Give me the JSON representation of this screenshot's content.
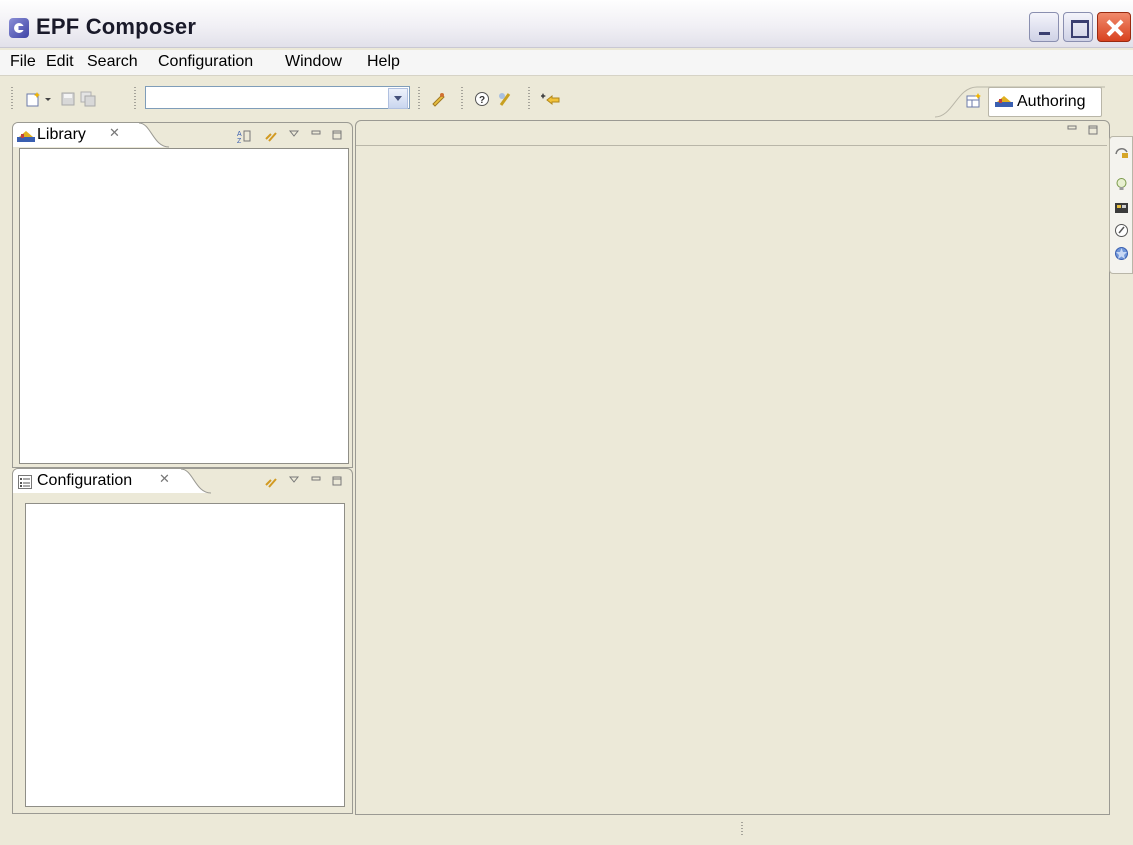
{
  "window": {
    "title": "EPF Composer"
  },
  "menu": {
    "items": [
      "File",
      "Edit",
      "Search",
      "Configuration",
      "Window",
      "Help"
    ]
  },
  "toolbar": {
    "combo_value": ""
  },
  "perspective": {
    "label": "Authoring"
  },
  "views": {
    "library": {
      "title": "Library"
    },
    "configuration": {
      "title": "Configuration"
    }
  },
  "icons": {
    "tab_close": "✕",
    "colors": {
      "accent": "#316ac5",
      "frame": "#ece9d8",
      "close_button": "#d8421f"
    }
  }
}
